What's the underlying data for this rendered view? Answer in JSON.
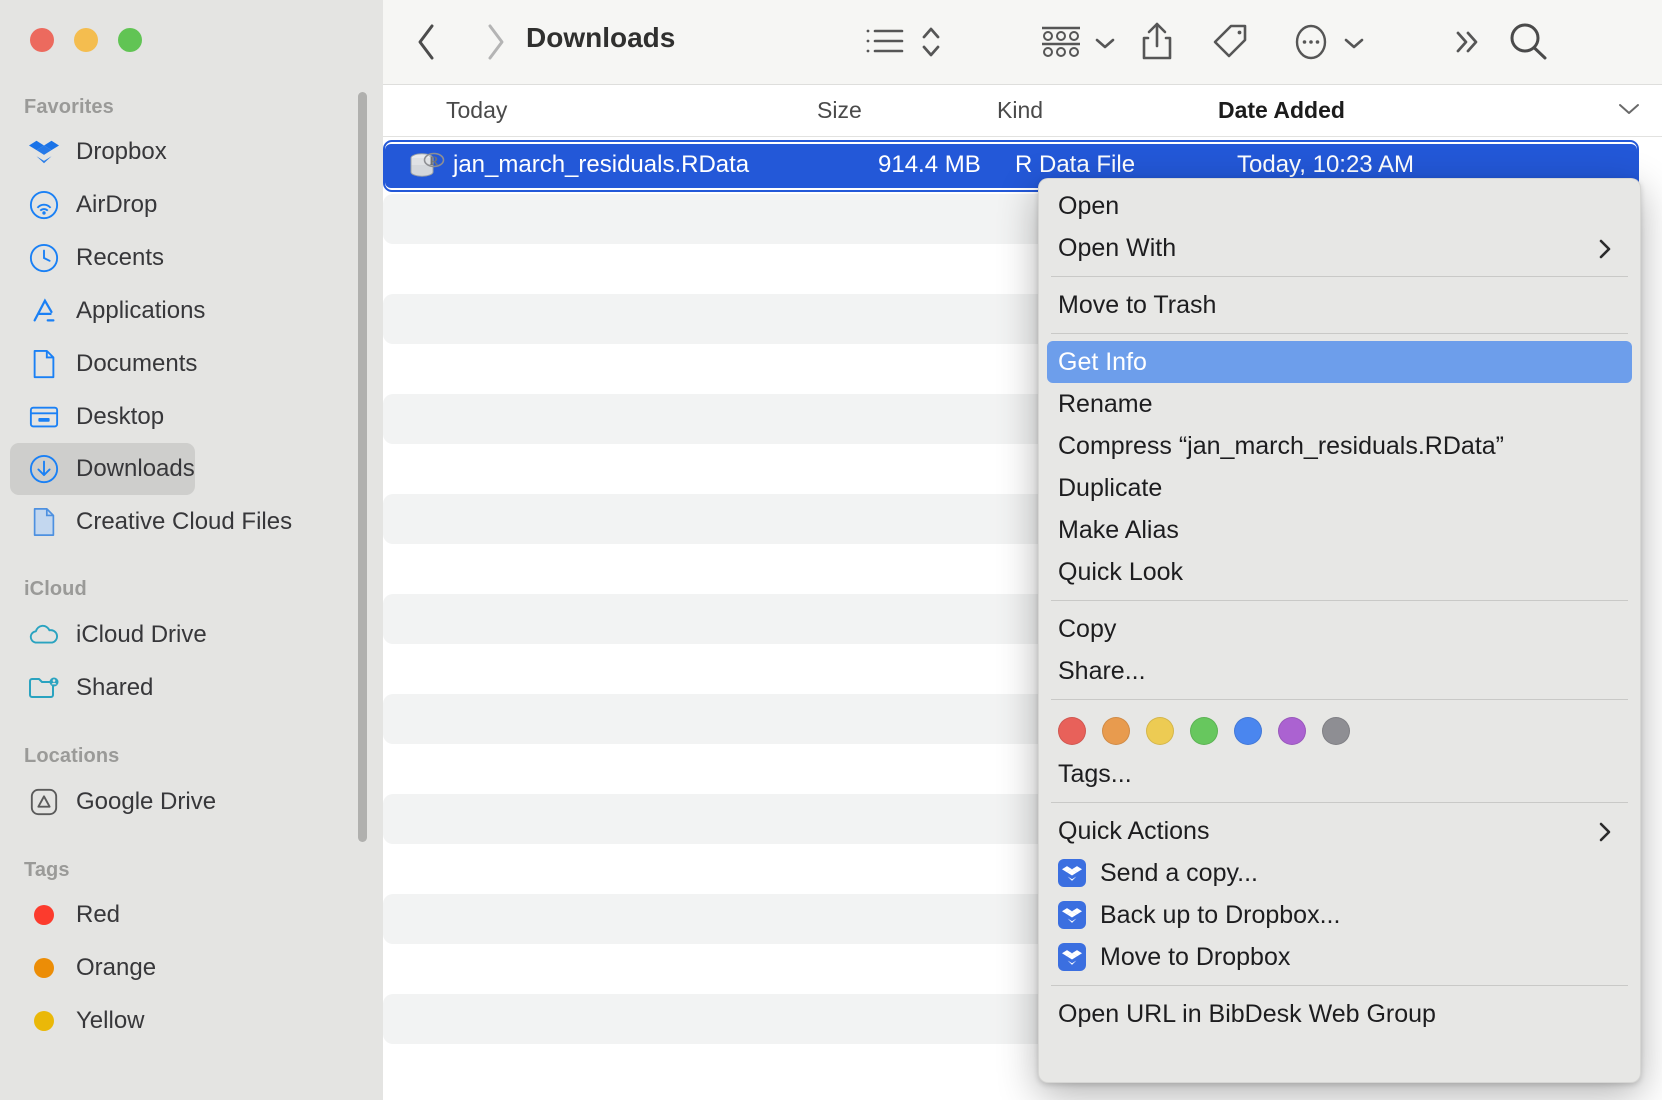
{
  "window": {
    "title": "Downloads",
    "traffic_lights": [
      {
        "name": "close",
        "color": "#ec6a5e"
      },
      {
        "name": "minimize",
        "color": "#f4bd4f"
      },
      {
        "name": "zoom",
        "color": "#61c454"
      }
    ]
  },
  "sidebar": {
    "sections": [
      {
        "header": "Favorites",
        "items": [
          {
            "label": "Dropbox",
            "icon": "dropbox-icon",
            "selected": false
          },
          {
            "label": "AirDrop",
            "icon": "airdrop-icon",
            "selected": false
          },
          {
            "label": "Recents",
            "icon": "clock-icon",
            "selected": false
          },
          {
            "label": "Applications",
            "icon": "applications-icon",
            "selected": false
          },
          {
            "label": "Documents",
            "icon": "document-icon",
            "selected": false
          },
          {
            "label": "Desktop",
            "icon": "desktop-icon",
            "selected": false
          },
          {
            "label": "Downloads",
            "icon": "download-icon",
            "selected": true
          },
          {
            "label": "Creative Cloud Files",
            "icon": "cc-file-icon",
            "selected": false
          }
        ]
      },
      {
        "header": "iCloud",
        "items": [
          {
            "label": "iCloud Drive",
            "icon": "cloud-icon",
            "selected": false
          },
          {
            "label": "Shared",
            "icon": "shared-folder-icon",
            "selected": false
          }
        ]
      },
      {
        "header": "Locations",
        "items": [
          {
            "label": "Google Drive",
            "icon": "google-drive-icon",
            "selected": false
          }
        ]
      },
      {
        "header": "Tags",
        "items": [
          {
            "label": "Red",
            "icon": "tag-dot-icon",
            "color": "#fc3b2d",
            "selected": false
          },
          {
            "label": "Orange",
            "icon": "tag-dot-icon",
            "color": "#ec8d06",
            "selected": false
          },
          {
            "label": "Yellow",
            "icon": "tag-dot-icon",
            "color": "#eab808",
            "selected": false
          }
        ]
      }
    ]
  },
  "toolbar": {
    "back": "back-icon",
    "forward": "forward-icon",
    "title": "Downloads",
    "list_view": "list-view-icon",
    "sort": "sort-updown-icon",
    "group": "group-icon",
    "group_chevron": "chevron-down-icon",
    "share": "share-icon",
    "tags": "tag-icon",
    "more": "more-ellipsis-icon",
    "more_chevron": "chevron-down-icon",
    "overflow": "double-chevron-icon",
    "search": "search-icon"
  },
  "columns": {
    "headers": [
      "Today",
      "Size",
      "Kind",
      "Date Added"
    ],
    "sorted_by": "Date Added",
    "disclosure": "chevron-down-icon"
  },
  "file_list": {
    "rows": [
      {
        "name": "jan_march_residuals.RData",
        "size": "914.4 MB",
        "kind": "R Data File",
        "date_added": "Today, 10:23 AM",
        "icon": "rdata-file-icon",
        "selected": true
      }
    ],
    "empty_row_count": 19
  },
  "context_menu": {
    "groups": [
      {
        "items": [
          {
            "label": "Open",
            "type": "item"
          },
          {
            "label": "Open With",
            "type": "submenu",
            "arrow": "chevron-right-icon"
          }
        ]
      },
      {
        "items": [
          {
            "label": "Move to Trash",
            "type": "item"
          }
        ]
      },
      {
        "items": [
          {
            "label": "Get Info",
            "type": "item",
            "highlighted": true
          },
          {
            "label": "Rename",
            "type": "item"
          },
          {
            "label": "Compress “jan_march_residuals.RData”",
            "type": "item"
          },
          {
            "label": "Duplicate",
            "type": "item"
          },
          {
            "label": "Make Alias",
            "type": "item"
          },
          {
            "label": "Quick Look",
            "type": "item"
          }
        ]
      },
      {
        "items": [
          {
            "label": "Copy",
            "type": "item"
          },
          {
            "label": "Share...",
            "type": "item"
          }
        ]
      },
      {
        "type": "tag-swatches",
        "swatches": [
          {
            "name": "red-tag-swatch",
            "color": "#e8615a"
          },
          {
            "name": "orange-tag-swatch",
            "color": "#e89b4e"
          },
          {
            "name": "yellow-tag-swatch",
            "color": "#edcb53"
          },
          {
            "name": "green-tag-swatch",
            "color": "#67c75e"
          },
          {
            "name": "blue-tag-swatch",
            "color": "#4a86ef"
          },
          {
            "name": "purple-tag-swatch",
            "color": "#ab62d1"
          },
          {
            "name": "gray-tag-swatch",
            "color": "#8e8e93"
          }
        ],
        "items": [
          {
            "label": "Tags...",
            "type": "item"
          }
        ]
      },
      {
        "items": [
          {
            "label": "Quick Actions",
            "type": "submenu",
            "arrow": "chevron-right-icon"
          },
          {
            "label": "Send a copy...",
            "type": "item",
            "icon": "dropbox-icon"
          },
          {
            "label": "Back up to Dropbox...",
            "type": "item",
            "icon": "dropbox-icon"
          },
          {
            "label": "Move to Dropbox",
            "type": "item",
            "icon": "dropbox-icon"
          }
        ]
      },
      {
        "items": [
          {
            "label": "Open URL in BibDesk Web Group",
            "type": "item",
            "clipped": true
          }
        ]
      }
    ]
  },
  "colors": {
    "selection_blue": "#2358d8",
    "menu_highlight": "#6d9eeb",
    "sidebar_bg": "#e4e4e2",
    "menu_bg": "#e7e7e5",
    "toolbar_bg": "#f6f6f4",
    "stripe": "#f2f3f3",
    "accent_icon_blue": "#1a80f5"
  }
}
